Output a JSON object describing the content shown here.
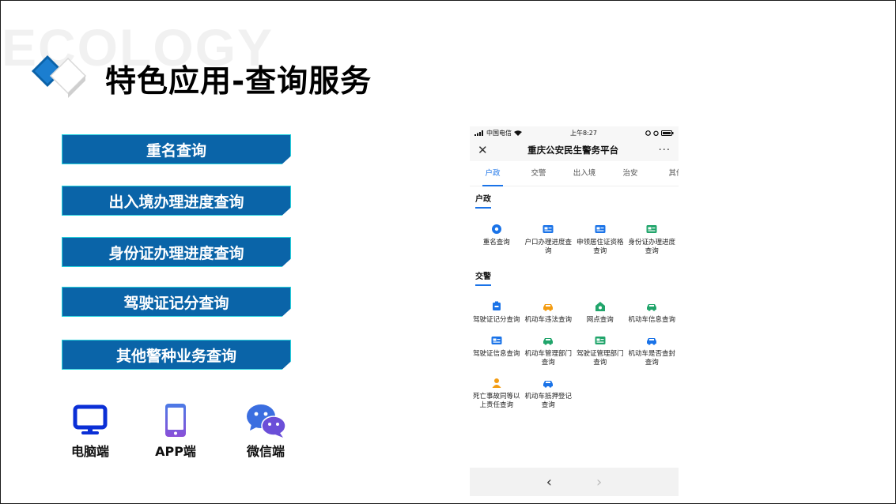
{
  "slide": {
    "watermark": "ECOLOGY",
    "title": "特色应用-查询服务"
  },
  "services": [
    "重名查询",
    "出入境办理进度查询",
    "身份证办理进度查询",
    "驾驶证记分查询",
    "其他警种业务查询"
  ],
  "platforms": [
    {
      "label": "电脑端",
      "icon": "monitor-icon"
    },
    {
      "label": "APP端",
      "icon": "mobile-phone-icon"
    },
    {
      "label": "微信端",
      "icon": "wechat-icon"
    }
  ],
  "phone": {
    "status": {
      "carrier": "中国电信",
      "time": "上午8:27"
    },
    "nav": {
      "close": "✕",
      "title": "重庆公安民生警务平台",
      "more": "···"
    },
    "tabs": [
      "户政",
      "交警",
      "出入境",
      "治安",
      "其他"
    ],
    "active_tab": "户政",
    "sections": [
      {
        "title": "户政",
        "items": [
          {
            "label": "重名查询",
            "icon": "name-search-icon",
            "color": "#1a73e8"
          },
          {
            "label": "户口办理进度查询",
            "icon": "household-card-icon",
            "color": "#1a73e8"
          },
          {
            "label": "申领居住证资格查询",
            "icon": "residence-card-icon",
            "color": "#1a73e8"
          },
          {
            "label": "身份证办理进度查询",
            "icon": "id-card-icon",
            "color": "#21a56b"
          }
        ]
      },
      {
        "title": "交警",
        "items": [
          {
            "label": "驾驶证记分查询",
            "icon": "license-score-icon",
            "color": "#1a73e8"
          },
          {
            "label": "机动车违法查询",
            "icon": "car-violation-icon",
            "color": "#f39c12"
          },
          {
            "label": "网点查询",
            "icon": "branch-location-icon",
            "color": "#21a56b"
          },
          {
            "label": "机动车信息查询",
            "icon": "car-info-icon",
            "color": "#21a56b"
          },
          {
            "label": "驾驶证信息查询",
            "icon": "license-info-icon",
            "color": "#1a73e8"
          },
          {
            "label": "机动车管理部门查询",
            "icon": "car-dept-icon",
            "color": "#21a56b"
          },
          {
            "label": "驾驶证管理部门查询",
            "icon": "license-dept-icon",
            "color": "#21a56b"
          },
          {
            "label": "机动车是否查封查询",
            "icon": "car-seal-icon",
            "color": "#1a73e8"
          },
          {
            "label": "死亡事故同等以上责任查询",
            "icon": "accident-icon",
            "color": "#f39c12"
          },
          {
            "label": "机动车抵押登记查询",
            "icon": "car-mortgage-icon",
            "color": "#1a73e8"
          }
        ]
      }
    ],
    "bottom": {
      "back": "‹",
      "forward": "›"
    }
  },
  "colors": {
    "button_bg": "#0a64a8",
    "button_border": "#27d3de",
    "accent_blue": "#1a73e8",
    "accent_green": "#21a56b",
    "accent_orange": "#f39c12"
  }
}
